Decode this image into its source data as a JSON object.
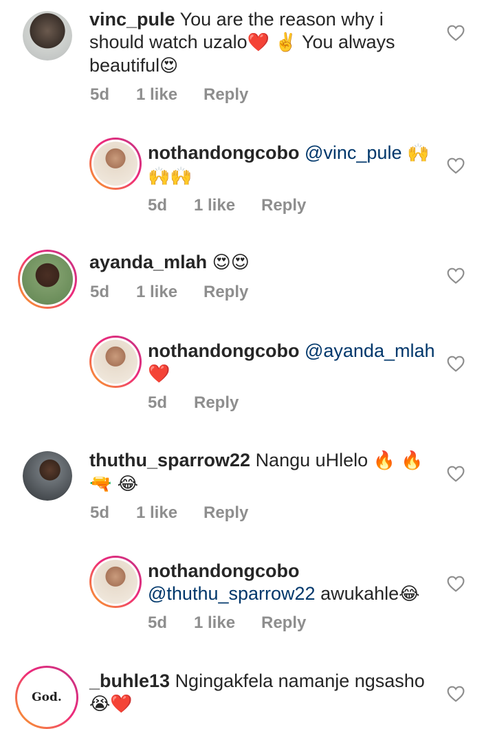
{
  "comments": [
    {
      "username": "vinc_pule",
      "text_before": "You are the reason why i should watch uzalo",
      "text_mid": "You always beautiful",
      "emojis": [
        "❤️",
        "✌️",
        "😍"
      ],
      "time": "5d",
      "likes": "1 like",
      "reply": "Reply",
      "avatar_icon": "avatar-man-hat"
    },
    {
      "username": "nothandongcobo",
      "mention": "@vinc_pule",
      "emojis": "🙌🙌🙌",
      "time": "5d",
      "likes": "1 like",
      "reply": "Reply",
      "avatar_icon": "avatar-woman"
    },
    {
      "username": "ayanda_mlah",
      "emojis": "😍😍",
      "time": "5d",
      "likes": "1 like",
      "reply": "Reply",
      "avatar_icon": "avatar-woman-green"
    },
    {
      "username": "nothandongcobo",
      "mention": "@ayanda_mlah",
      "emojis": "❤️",
      "time": "5d",
      "reply": "Reply",
      "avatar_icon": "avatar-woman"
    },
    {
      "username": "thuthu_sparrow22",
      "text": "Nangu uHlelo",
      "emojis_line1": "🔥 🔥",
      "emojis_line2": "🔫 😂",
      "time": "5d",
      "likes": "1 like",
      "reply": "Reply",
      "avatar_icon": "avatar-man-office"
    },
    {
      "username": "nothandongcobo",
      "mention": "@thuthu_sparrow22",
      "text": "awukahle",
      "emojis": "😂",
      "time": "5d",
      "likes": "1 like",
      "reply": "Reply",
      "avatar_icon": "avatar-woman"
    },
    {
      "username": "_buhle13",
      "text": "Ngingakfela namanje ngsasho",
      "emojis": "😭❤️",
      "avatar_text": "God.",
      "avatar_icon": "avatar-god-text"
    }
  ],
  "colors": {
    "text": "#262626",
    "meta": "#8e8e8e",
    "mention": "#00376b",
    "heart_outline": "#8e8e8e"
  }
}
